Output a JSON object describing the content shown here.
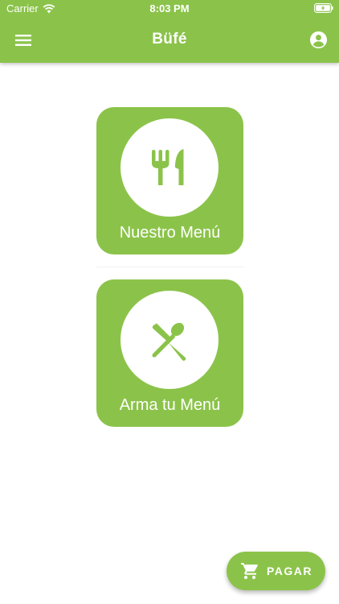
{
  "status_bar": {
    "carrier": "Carrier",
    "time": "8:03 PM"
  },
  "app_bar": {
    "title": "Büfé"
  },
  "cards": [
    {
      "label": "Nuestro Menú",
      "icon": "cutlery-icon"
    },
    {
      "label": "Arma tu Menú",
      "icon": "crossed-utensils-icon"
    }
  ],
  "fab": {
    "label": "PAGAR",
    "icon": "cart-icon"
  },
  "colors": {
    "primary": "#8BC34A",
    "surface": "#FFFFFF"
  }
}
